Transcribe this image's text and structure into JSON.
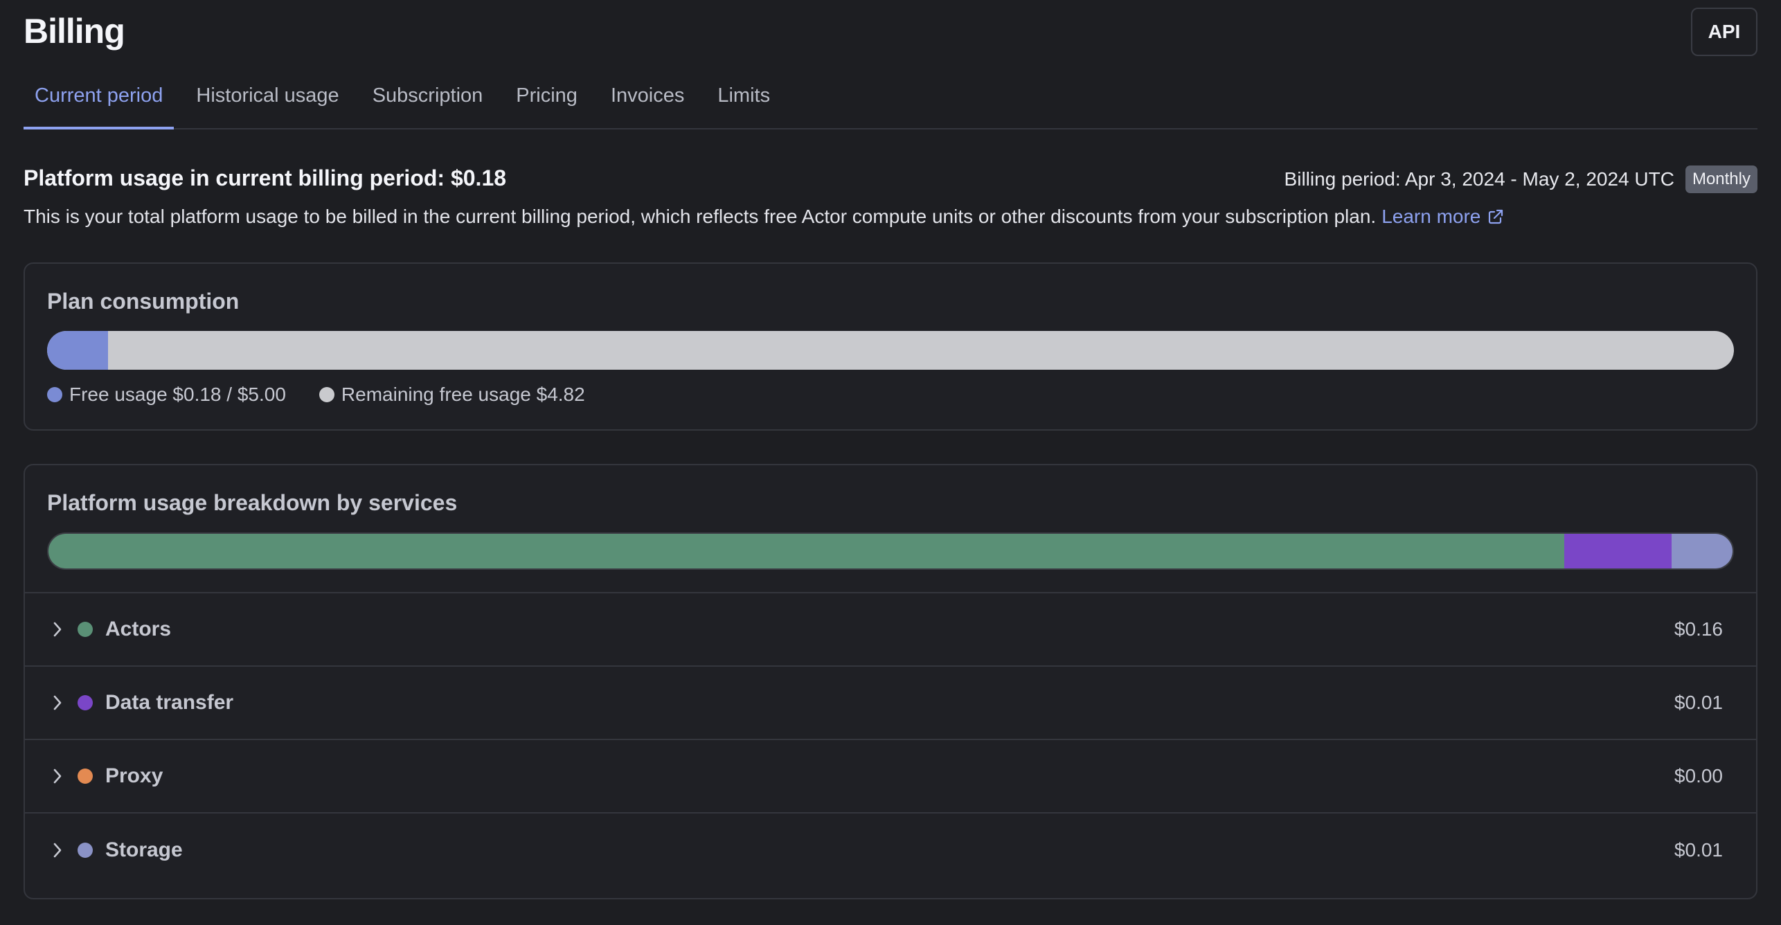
{
  "header": {
    "title": "Billing",
    "api_label": "API"
  },
  "tabs": [
    {
      "label": "Current period",
      "active": true
    },
    {
      "label": "Historical usage",
      "active": false
    },
    {
      "label": "Subscription",
      "active": false
    },
    {
      "label": "Pricing",
      "active": false
    },
    {
      "label": "Invoices",
      "active": false
    },
    {
      "label": "Limits",
      "active": false
    }
  ],
  "usage": {
    "title": "Platform usage in current billing period: $0.18",
    "billing_period": "Billing period: Apr 3, 2024 - May 2, 2024 UTC",
    "period_badge": "Monthly",
    "description": "This is your total platform usage to be billed in the current billing period, which reflects free Actor compute units or other discounts from your subscription plan.",
    "learn_more": "Learn more",
    "learn_more_icon": "external-link-icon"
  },
  "plan": {
    "title": "Plan consumption",
    "used_fraction": 0.036,
    "used_color": "#7a8bd4",
    "remaining_color": "#c9cace",
    "legend": [
      {
        "label": "Free usage $0.18 / $5.00",
        "color": "#7a8bd4"
      },
      {
        "label": "Remaining free usage $4.82",
        "color": "#c9cace"
      }
    ]
  },
  "services": {
    "title": "Platform usage breakdown by services",
    "bar_segments": [
      {
        "name": "Actors",
        "fraction": 0.9,
        "color": "#5a9076"
      },
      {
        "name": "Data transfer",
        "fraction": 0.064,
        "color": "#7a46c7"
      },
      {
        "name": "Proxy",
        "fraction": 0.0,
        "color": "#e38a52"
      },
      {
        "name": "Storage",
        "fraction": 0.036,
        "color": "#8a92c6"
      }
    ],
    "rows": [
      {
        "name": "Actors",
        "amount": "$0.16",
        "color": "#5a9076"
      },
      {
        "name": "Data transfer",
        "amount": "$0.01",
        "color": "#7a46c7"
      },
      {
        "name": "Proxy",
        "amount": "$0.00",
        "color": "#e38a52"
      },
      {
        "name": "Storage",
        "amount": "$0.01",
        "color": "#8a92c6"
      }
    ]
  }
}
